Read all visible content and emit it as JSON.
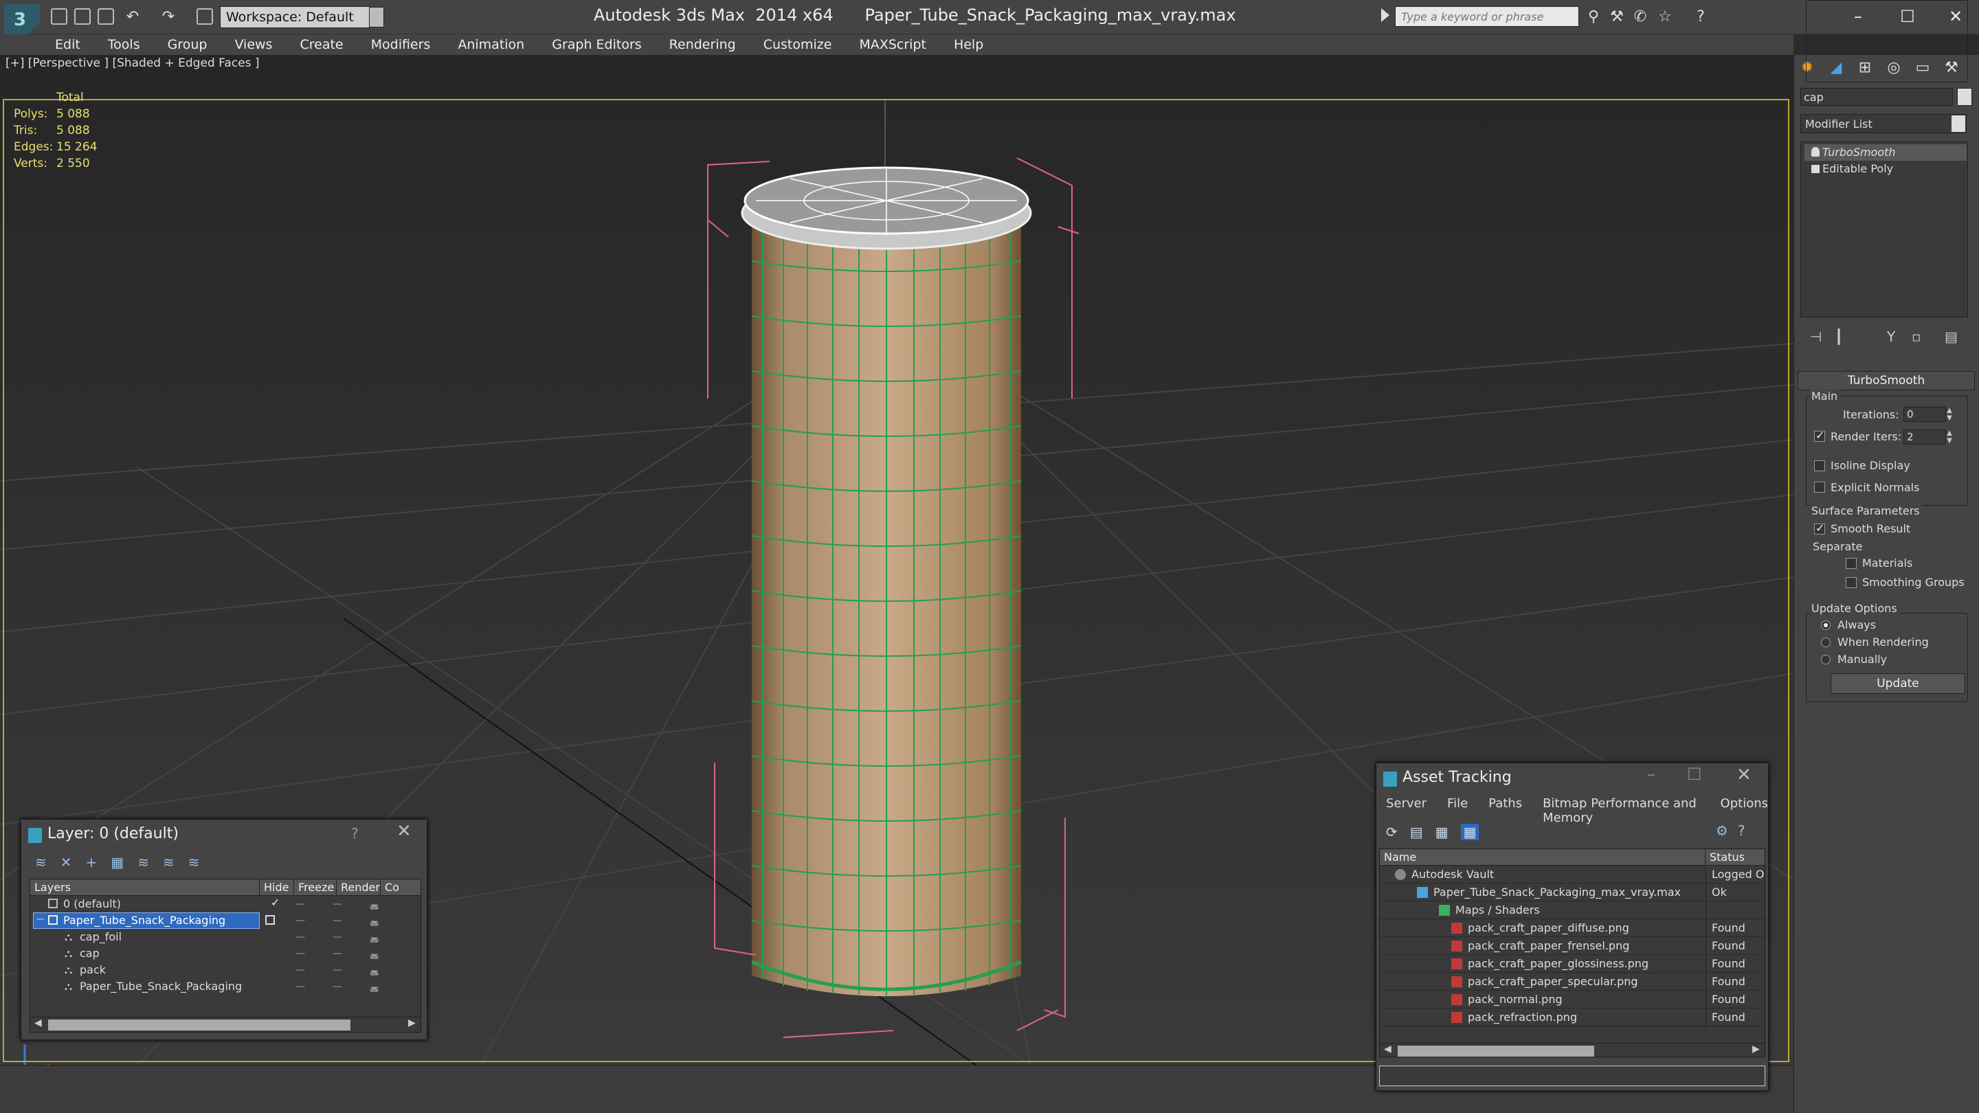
{
  "app": {
    "title": "Autodesk 3ds Max  2014 x64",
    "file": "Paper_Tube_Snack_Packaging_max_vray.max",
    "workspace": "Workspace: Default",
    "search_placeholder": "Type a keyword or phrase",
    "logo": "3"
  },
  "menu": [
    "Edit",
    "Tools",
    "Group",
    "Views",
    "Create",
    "Modifiers",
    "Animation",
    "Graph Editors",
    "Rendering",
    "Customize",
    "MAXScript",
    "Help"
  ],
  "viewport": {
    "label": "[+] [Perspective ] [Shaded + Edged Faces ]",
    "stats_header": "Total",
    "stats": [
      {
        "label": "Polys:",
        "value": "5 088"
      },
      {
        "label": "Tris:",
        "value": "5 088"
      },
      {
        "label": "Edges:",
        "value": "15 264"
      },
      {
        "label": "Verts:",
        "value": "2 550"
      }
    ]
  },
  "command_panel": {
    "object_name": "cap",
    "modifier_list": "Modifier List",
    "stack": [
      "TurboSmooth",
      "Editable Poly"
    ],
    "rollout": "TurboSmooth",
    "main_group": "Main",
    "iterations_label": "Iterations:",
    "iterations_value": "0",
    "render_iters_label": "Render Iters:",
    "render_iters_value": "2",
    "isoline": "Isoline Display",
    "explicit": "Explicit Normals",
    "surface_group": "Surface Parameters",
    "smooth_result": "Smooth Result",
    "separate": "Separate",
    "materials": "Materials",
    "smoothing_groups": "Smoothing Groups",
    "update_group": "Update Options",
    "always": "Always",
    "when_rendering": "When Rendering",
    "manually": "Manually",
    "update_btn": "Update"
  },
  "layer_dialog": {
    "title": "Layer: 0 (default)",
    "help": "?",
    "columns": [
      "Layers",
      "Hide",
      "Freeze",
      "Render",
      "Co"
    ],
    "rows": [
      {
        "name": "0 (default)",
        "level": 0
      },
      {
        "name": "Paper_Tube_Snack_Packaging",
        "level": 0
      },
      {
        "name": "cap_foil",
        "level": 1
      },
      {
        "name": "cap",
        "level": 1
      },
      {
        "name": "pack",
        "level": 1
      },
      {
        "name": "Paper_Tube_Snack_Packaging",
        "level": 1
      }
    ]
  },
  "asset_dialog": {
    "title": "Asset Tracking",
    "menu": [
      "Server",
      "File",
      "Paths",
      "Bitmap Performance and Memory",
      "Options"
    ],
    "columns": [
      "Name",
      "Status"
    ],
    "rows": [
      {
        "name": "Autodesk Vault",
        "status": "Logged O",
        "level": 0,
        "type": "vault"
      },
      {
        "name": "Paper_Tube_Snack_Packaging_max_vray.max",
        "status": "Ok",
        "level": 1,
        "type": "max"
      },
      {
        "name": "Maps / Shaders",
        "status": "",
        "level": 2,
        "type": "maps"
      },
      {
        "name": "pack_craft_paper_diffuse.png",
        "status": "Found",
        "level": 3,
        "type": "png"
      },
      {
        "name": "pack_craft_paper_frensel.png",
        "status": "Found",
        "level": 3,
        "type": "png"
      },
      {
        "name": "pack_craft_paper_glossiness.png",
        "status": "Found",
        "level": 3,
        "type": "png"
      },
      {
        "name": "pack_craft_paper_specular.png",
        "status": "Found",
        "level": 3,
        "type": "png"
      },
      {
        "name": "pack_normal.png",
        "status": "Found",
        "level": 3,
        "type": "png"
      },
      {
        "name": "pack_refraction.png",
        "status": "Found",
        "level": 3,
        "type": "png"
      }
    ]
  }
}
